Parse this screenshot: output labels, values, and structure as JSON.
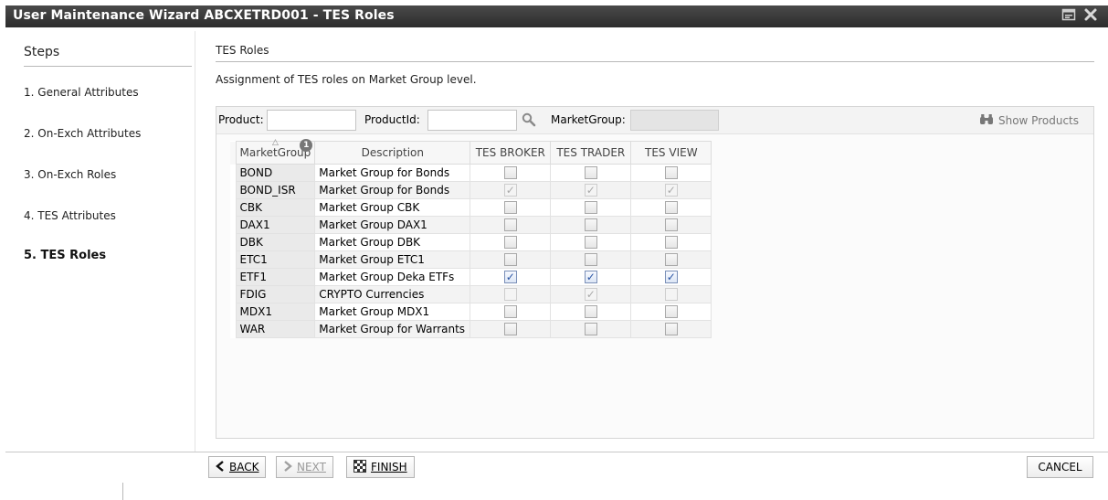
{
  "window": {
    "title": "User Maintenance Wizard ABCXETRD001 - TES Roles",
    "icons": [
      "window-menu-icon",
      "close-icon"
    ]
  },
  "steps": {
    "header": "Steps",
    "items": [
      {
        "label": "1. General Attributes",
        "active": false
      },
      {
        "label": "2. On-Exch Attributes",
        "active": false
      },
      {
        "label": "3. On-Exch Roles",
        "active": false
      },
      {
        "label": "4. TES Attributes",
        "active": false
      },
      {
        "label": "5. TES Roles",
        "active": true
      }
    ]
  },
  "main": {
    "title": "TES Roles",
    "description": "Assignment of TES roles on Market Group level.",
    "filters": {
      "product_label": "Product:",
      "product_value": "",
      "productid_label": "ProductId:",
      "productid_value": "",
      "marketgroup_label": "MarketGroup:",
      "marketgroup_value": "",
      "show_products_label": "Show Products"
    },
    "grid": {
      "columns": [
        "MarketGroup",
        "Description",
        "TES BROKER",
        "TES TRADER",
        "TES VIEW"
      ],
      "sort_badge": "1",
      "rows": [
        {
          "mg": "BOND",
          "desc": "Market Group for Bonds",
          "broker": "unchecked",
          "trader": "unchecked",
          "view": "unchecked"
        },
        {
          "mg": "BOND_ISR",
          "desc": "Market Group for Bonds",
          "broker": "checked-disabled",
          "trader": "checked-disabled",
          "view": "checked-disabled"
        },
        {
          "mg": "CBK",
          "desc": "Market Group CBK",
          "broker": "unchecked",
          "trader": "unchecked",
          "view": "unchecked"
        },
        {
          "mg": "DAX1",
          "desc": "Market Group DAX1",
          "broker": "unchecked",
          "trader": "unchecked",
          "view": "unchecked"
        },
        {
          "mg": "DBK",
          "desc": "Market Group DBK",
          "broker": "unchecked",
          "trader": "unchecked",
          "view": "unchecked"
        },
        {
          "mg": "ETC1",
          "desc": "Market Group ETC1",
          "broker": "unchecked",
          "trader": "unchecked",
          "view": "unchecked"
        },
        {
          "mg": "ETF1",
          "desc": "Market Group Deka ETFs",
          "broker": "checked",
          "trader": "checked",
          "view": "checked"
        },
        {
          "mg": "FDIG",
          "desc": "CRYPTO Currencies",
          "broker": "disabled",
          "trader": "checked-disabled",
          "view": "disabled"
        },
        {
          "mg": "MDX1",
          "desc": "Market Group MDX1",
          "broker": "unchecked",
          "trader": "unchecked",
          "view": "unchecked"
        },
        {
          "mg": "WAR",
          "desc": "Market Group for Warrants",
          "broker": "unchecked",
          "trader": "unchecked",
          "view": "unchecked"
        }
      ]
    }
  },
  "footer": {
    "back_label": "BACK",
    "next_label": "NEXT",
    "finish_label": "FINISH",
    "cancel_label": "CANCEL"
  }
}
